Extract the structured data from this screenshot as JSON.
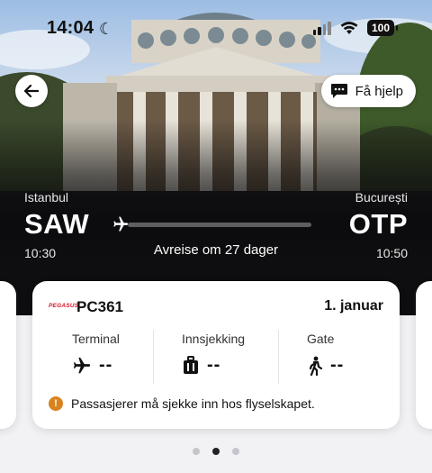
{
  "status_bar": {
    "time": "14:04",
    "battery": "100",
    "icons": [
      "moon-icon",
      "signal-icon",
      "wifi-icon",
      "battery-icon"
    ]
  },
  "header": {
    "back_icon": "arrow-left-icon",
    "help_label": "Få hjelp",
    "help_icon": "chat-icon"
  },
  "trip": {
    "origin": {
      "city": "Istanbul",
      "code": "SAW",
      "time": "10:30"
    },
    "destination": {
      "city": "București",
      "code": "OTP",
      "time": "10:50"
    },
    "departs_text": "Avreise om 27 dager",
    "progress": 0
  },
  "flight_card": {
    "airline_logo_text": "PEGASUS",
    "flight_number": "PC361",
    "date": "1. januar",
    "columns": [
      {
        "label": "Terminal",
        "value": "--",
        "icon": "airplane-icon"
      },
      {
        "label": "Innsjekking",
        "value": "--",
        "icon": "luggage-icon"
      },
      {
        "label": "Gate",
        "value": "--",
        "icon": "walking-person-icon"
      }
    ],
    "notice": "Passasjerer må sjekke inn hos flyselskapet.",
    "notice_icon": "warning-icon"
  },
  "pagination": {
    "count": 3,
    "active": 1
  },
  "colors": {
    "accent_warning": "#d9831f",
    "airline_brand": "#d8152f",
    "dark": "#0e0e10"
  }
}
